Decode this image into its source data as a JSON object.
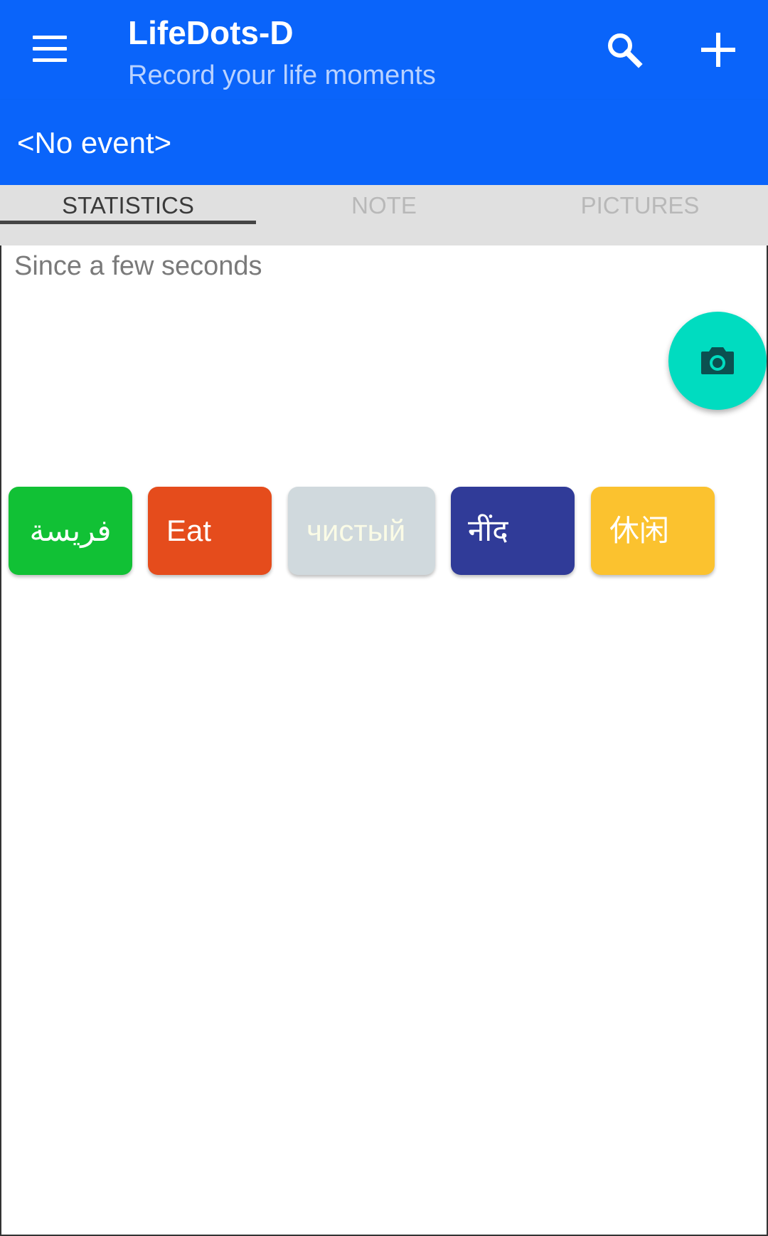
{
  "app": {
    "title": "LifeDots-D",
    "subtitle": "Record your life moments"
  },
  "toolbar": {
    "menu_icon": "hamburger-menu-icon",
    "search_icon": "search-icon",
    "add_icon": "plus-icon"
  },
  "event": {
    "label": "<No event>"
  },
  "tabs": [
    {
      "label": "STATISTICS",
      "active": true
    },
    {
      "label": "NOTE",
      "active": false
    },
    {
      "label": "PICTURES",
      "active": false
    }
  ],
  "statistics": {
    "since_text": "Since a few seconds"
  },
  "fab": {
    "icon": "camera-icon",
    "color": "#00dcc0"
  },
  "chips": [
    {
      "label": "فريسة",
      "color": "#11c135",
      "text_color": "#ffffff"
    },
    {
      "label": "Eat",
      "color": "#e54c1c",
      "text_color": "#ffffff"
    },
    {
      "label": "чистый",
      "color": "#d0d9dd",
      "text_color": "#fafbe6"
    },
    {
      "label": "नींद",
      "color": "#303b98",
      "text_color": "#ffffff"
    },
    {
      "label": "休闲",
      "color": "#fbc22f",
      "text_color": "#ffffff"
    }
  ],
  "colors": {
    "primary": "#0a64fa",
    "tab_background": "#e0e0e0",
    "accent": "#00dcc0"
  }
}
